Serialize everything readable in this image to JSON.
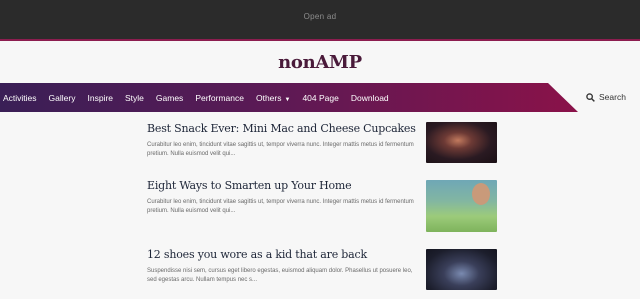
{
  "ad": {
    "label": "Open ad"
  },
  "site": {
    "logo": "nonAMP"
  },
  "nav": {
    "items": [
      {
        "label": "Activities"
      },
      {
        "label": "Gallery"
      },
      {
        "label": "Inspire"
      },
      {
        "label": "Style"
      },
      {
        "label": "Games"
      },
      {
        "label": "Performance"
      },
      {
        "label": "Others"
      },
      {
        "label": "404 Page"
      },
      {
        "label": "Download"
      }
    ],
    "search_label": "Search"
  },
  "colors": {
    "nav_start": "#3a1f56",
    "nav_end": "#8a1249",
    "ad_bar": "#2b2b2b",
    "accent": "#8c1d4f"
  },
  "posts": [
    {
      "title": "Best Snack Ever: Mini Mac and Cheese Cupcakes",
      "excerpt": "Curabitur leo enim, tincidunt vitae sagittis ut, tempor viverra nunc. Integer mattis metus id fermentum pretium. Nulla euismod velit qui...",
      "image": "person-crossed-arms-photo"
    },
    {
      "title": "Eight Ways to Smarten up Your Home",
      "excerpt": "Curabitur leo enim, tincidunt vitae sagittis ut, tempor viverra nunc. Integer mattis metus id fermentum pretium. Nulla euismod velit qui...",
      "image": "child-dandelion-photo"
    },
    {
      "title": "12 shoes you wore as a kid that are back",
      "excerpt": "Suspendisse nisi sem, cursus eget libero egestas, euismod aliquam dolor. Phasellus ut posuere leo, sed egestas arcu. Nullam tempus nec s...",
      "image": "glitter-face-photo"
    }
  ]
}
